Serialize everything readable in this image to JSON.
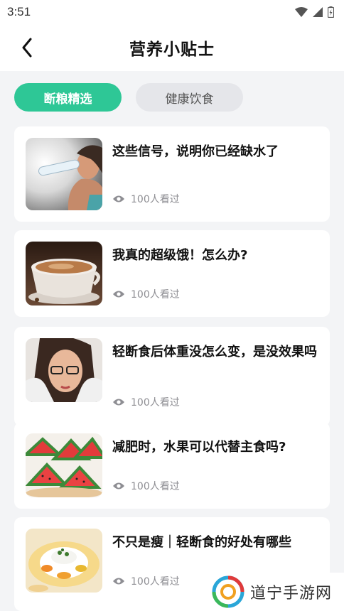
{
  "status_bar": {
    "time": "3:51"
  },
  "header": {
    "title": "营养小贴士"
  },
  "tabs": [
    {
      "label": "断粮精选",
      "active": true
    },
    {
      "label": "健康饮食",
      "active": false
    }
  ],
  "articles": [
    {
      "title": "这些信号，说明你已经缺水了",
      "views": "100人看过",
      "image": "woman-drinking-water"
    },
    {
      "title": "我真的超级饿！怎么办?",
      "views": "100人看过",
      "image": "coffee-cup"
    },
    {
      "title": "轻断食后体重没怎么变，是没效果吗",
      "views": "100人看过",
      "image": "stressed-woman-glasses"
    },
    {
      "title": "减肥时，水果可以代替主食吗?",
      "views": "100人看过",
      "image": "watermelon-slices"
    },
    {
      "title": "不只是瘦｜轻断食的好处有哪些",
      "views": "100人看过",
      "image": "rice-bowl-meal"
    }
  ],
  "watermark": {
    "text": "道宁手游网"
  },
  "colors": {
    "accent": "#2ec796",
    "background": "#f3f4f6",
    "muted_text": "#8e8e93"
  }
}
